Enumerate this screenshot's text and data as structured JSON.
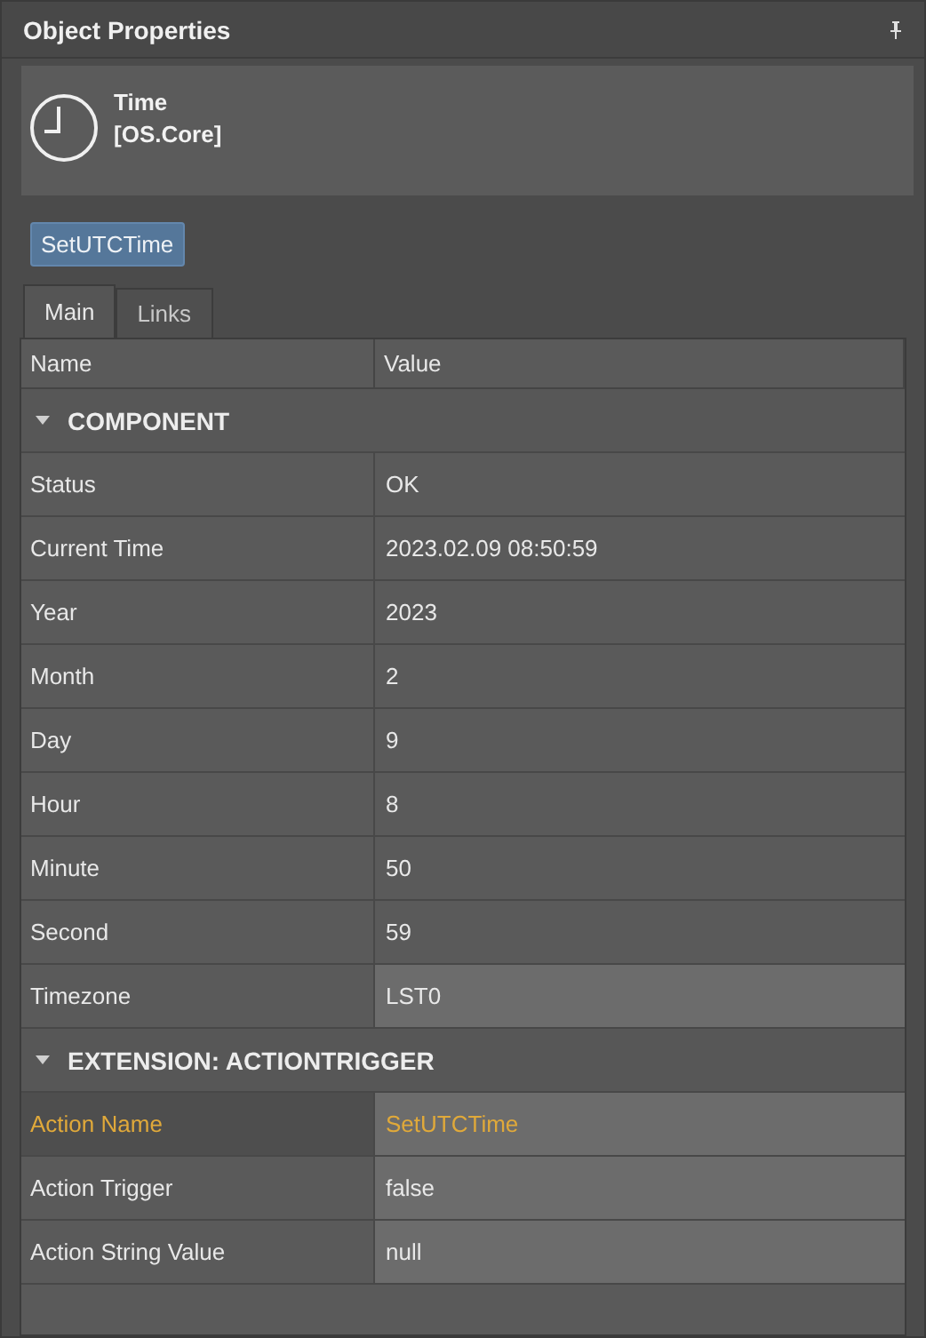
{
  "panel": {
    "title": "Object Properties"
  },
  "object": {
    "name": "Time",
    "library": "[OS.Core]"
  },
  "action_buttons": [
    "SetUTCTime"
  ],
  "tabs": [
    {
      "label": "Main",
      "selected": true
    },
    {
      "label": "Links",
      "selected": false
    }
  ],
  "table": {
    "columns": [
      "Name",
      "Value"
    ],
    "groups": [
      {
        "title": "COMPONENT",
        "expanded": true,
        "rows": [
          {
            "name": "Status",
            "value": "OK",
            "editable": false,
            "selected": false
          },
          {
            "name": "Current Time",
            "value": "2023.02.09 08:50:59",
            "editable": false,
            "selected": false
          },
          {
            "name": "Year",
            "value": "2023",
            "editable": false,
            "selected": false
          },
          {
            "name": "Month",
            "value": "2",
            "editable": false,
            "selected": false
          },
          {
            "name": "Day",
            "value": "9",
            "editable": false,
            "selected": false
          },
          {
            "name": "Hour",
            "value": "8",
            "editable": false,
            "selected": false
          },
          {
            "name": "Minute",
            "value": "50",
            "editable": false,
            "selected": false
          },
          {
            "name": "Second",
            "value": "59",
            "editable": false,
            "selected": false
          },
          {
            "name": "Timezone",
            "value": "LST0",
            "editable": true,
            "selected": false
          }
        ]
      },
      {
        "title": "EXTENSION: ACTIONTRIGGER",
        "expanded": true,
        "rows": [
          {
            "name": "Action Name",
            "value": "SetUTCTime",
            "editable": true,
            "selected": true
          },
          {
            "name": "Action Trigger",
            "value": "false",
            "editable": true,
            "selected": false
          },
          {
            "name": "Action String Value",
            "value": "null",
            "editable": true,
            "selected": false
          }
        ]
      }
    ]
  }
}
